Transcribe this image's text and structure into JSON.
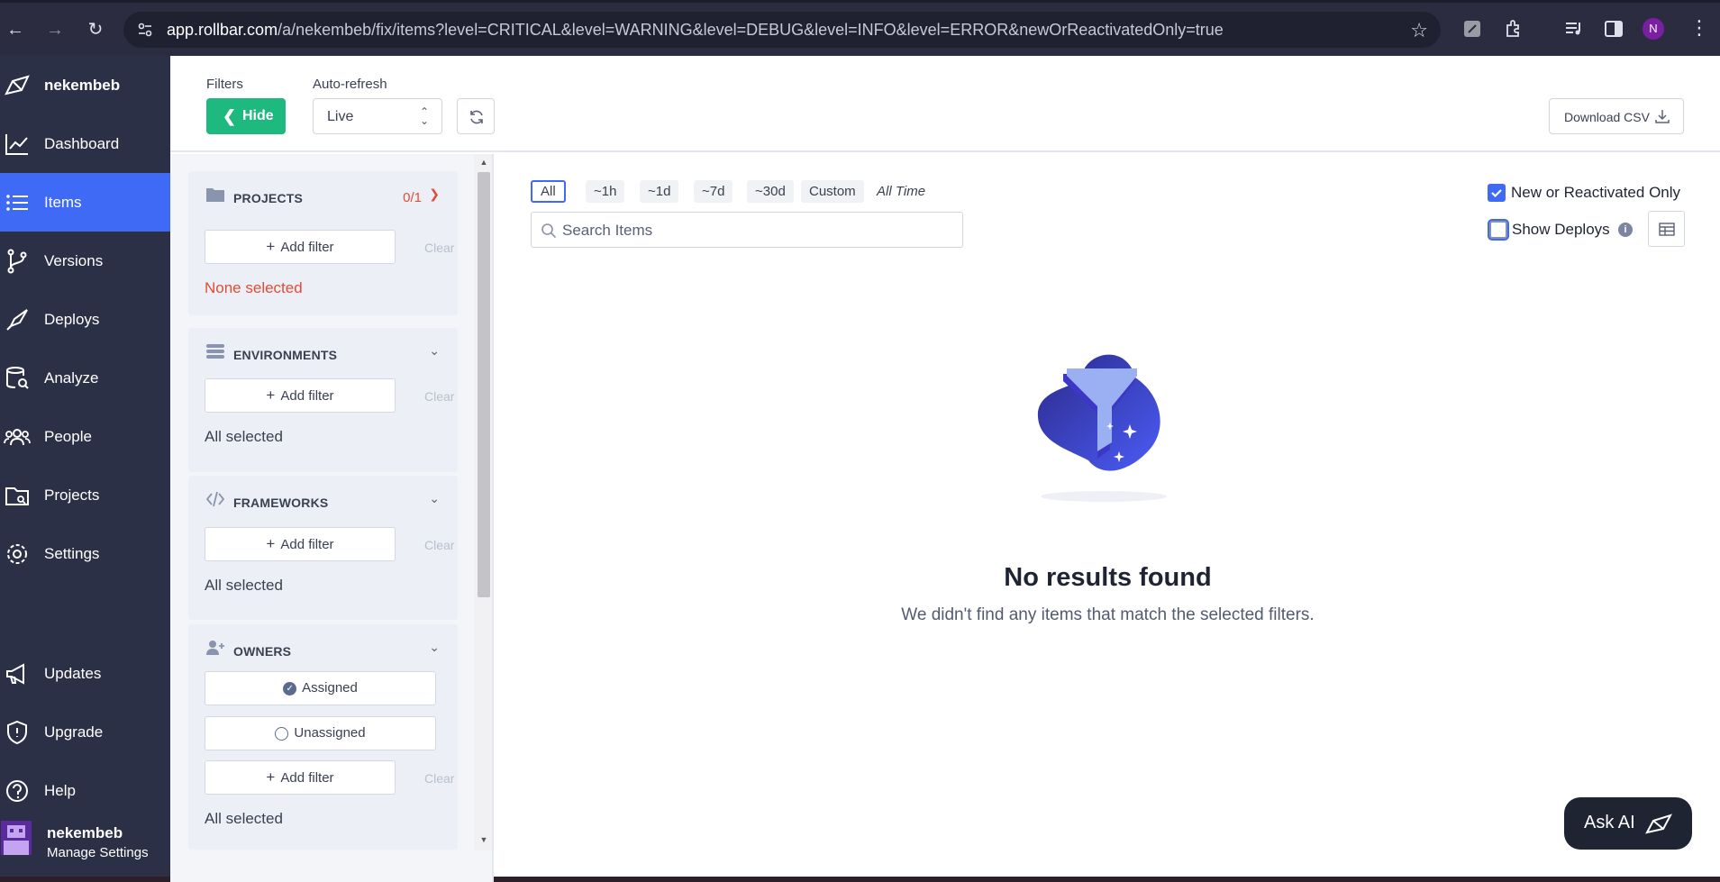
{
  "browser": {
    "url_domain": "app.rollbar.com",
    "url_path": "/a/nekembeb/fix/items?level=CRITICAL&level=WARNING&level=DEBUG&level=INFO&level=ERROR&newOrReactivatedOnly=true",
    "profile_initial": "N"
  },
  "sidebar": {
    "brand": "nekembeb",
    "items": [
      {
        "label": "Dashboard",
        "icon": "chart-line-icon"
      },
      {
        "label": "Items",
        "icon": "list-icon"
      },
      {
        "label": "Versions",
        "icon": "branch-icon"
      },
      {
        "label": "Deploys",
        "icon": "rocket-icon"
      },
      {
        "label": "Analyze",
        "icon": "analyze-icon"
      },
      {
        "label": "People",
        "icon": "people-icon"
      },
      {
        "label": "Projects",
        "icon": "folder-icon"
      },
      {
        "label": "Settings",
        "icon": "gear-icon"
      },
      {
        "label": "Updates",
        "icon": "megaphone-icon"
      },
      {
        "label": "Upgrade",
        "icon": "shield-icon"
      },
      {
        "label": "Help",
        "icon": "help-icon"
      }
    ],
    "active_item": "Items",
    "user": {
      "name": "nekembeb",
      "subtitle": "Manage Settings"
    }
  },
  "toolbar": {
    "filters_label": "Filters",
    "hide_label": "Hide",
    "autorefresh_label": "Auto-refresh",
    "autorefresh_value": "Live",
    "download_label": "Download CSV"
  },
  "filters": {
    "projects": {
      "title": "PROJECTS",
      "count": "0/1",
      "add_label": "Add filter",
      "clear_label": "Clear",
      "status": "None selected"
    },
    "environments": {
      "title": "ENVIRONMENTS",
      "add_label": "Add filter",
      "clear_label": "Clear",
      "status": "All selected"
    },
    "frameworks": {
      "title": "FRAMEWORKS",
      "add_label": "Add filter",
      "clear_label": "Clear",
      "status": "All selected"
    },
    "owners": {
      "title": "OWNERS",
      "assigned_label": "Assigned",
      "unassigned_label": "Unassigned",
      "add_label": "Add filter",
      "clear_label": "Clear",
      "status": "All selected"
    }
  },
  "main": {
    "time_ranges": [
      "All",
      "~1h",
      "~1d",
      "~7d",
      "~30d",
      "Custom"
    ],
    "time_range_selected": "All",
    "time_range_caption": "All Time",
    "search_placeholder": "Search Items",
    "new_or_reactivated_label": "New or Reactivated Only",
    "new_or_reactivated_checked": true,
    "show_deploys_label": "Show Deploys",
    "show_deploys_checked": false,
    "empty_title": "No results found",
    "empty_subtitle": "We didn't find any items that match the selected filters.",
    "ask_ai_label": "Ask AI"
  },
  "colors": {
    "accent": "#3e6af5",
    "success": "#1db97e",
    "danger": "#e04c37",
    "nav_bg": "#2c3046"
  }
}
